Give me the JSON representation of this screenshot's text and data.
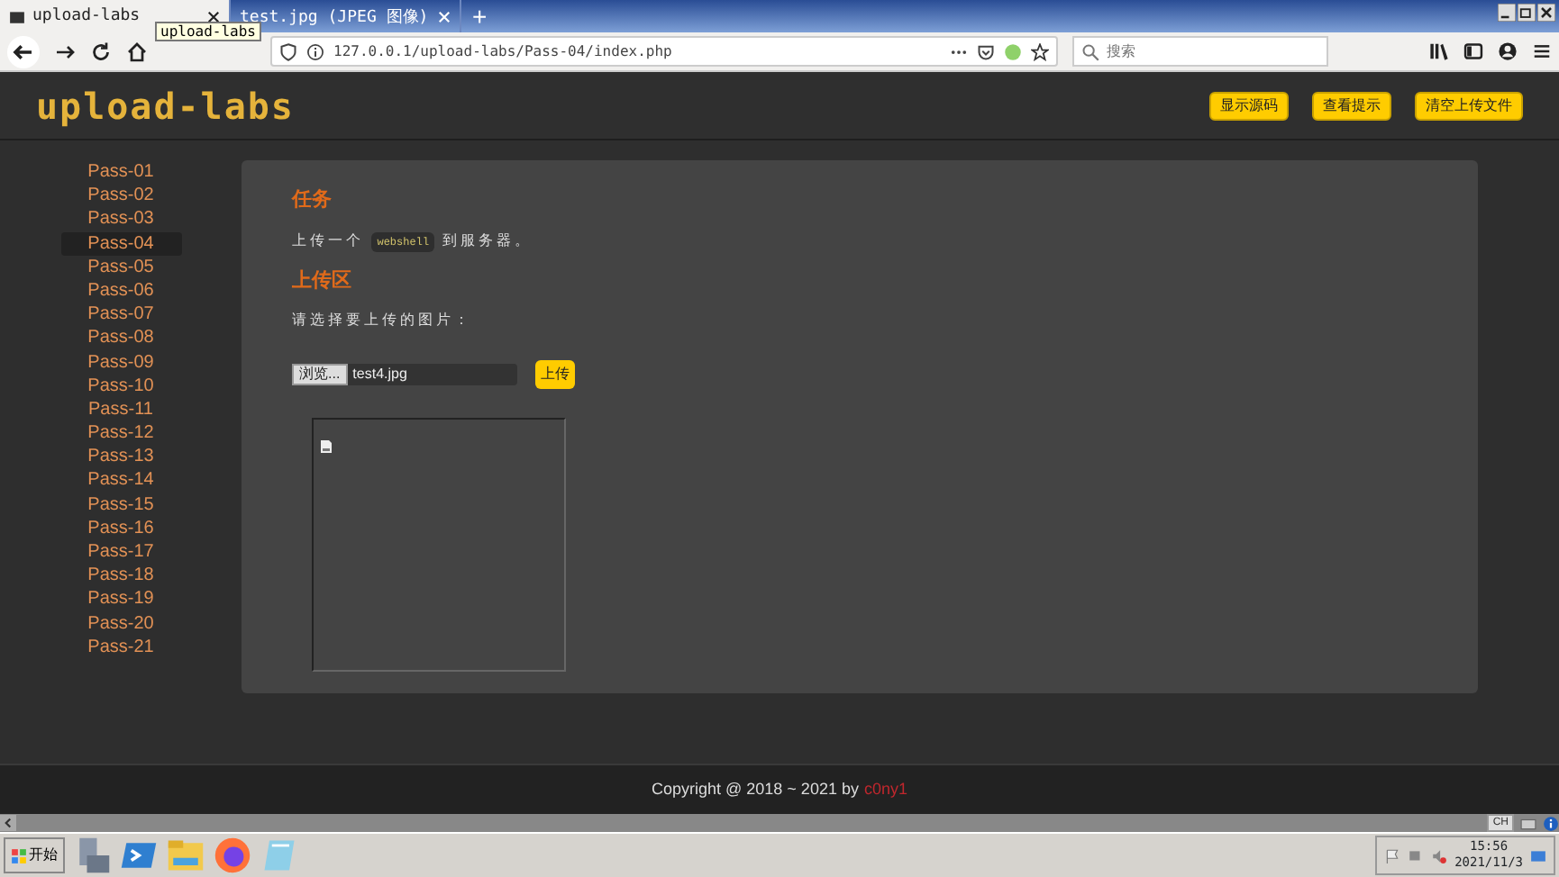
{
  "browser": {
    "tabs": [
      {
        "label": "upload-labs",
        "selected": true
      },
      {
        "label": "test.jpg (JPEG 图像)",
        "selected": false
      }
    ],
    "tooltip": "upload-labs",
    "new_tab": "+",
    "address": "127.0.0.1/upload-labs/Pass-04/index.php",
    "search": {
      "placeholder": "搜索"
    }
  },
  "header": {
    "logo": "upload-labs",
    "buttons": [
      "显示源码",
      "查看提示",
      "清空上传文件"
    ]
  },
  "sidebar": {
    "items": [
      {
        "label": "Pass-01",
        "selected": false
      },
      {
        "label": "Pass-02",
        "selected": false
      },
      {
        "label": "Pass-03",
        "selected": false
      },
      {
        "label": "Pass-04",
        "selected": true
      },
      {
        "label": "Pass-05",
        "selected": false
      },
      {
        "label": "Pass-06",
        "selected": false
      },
      {
        "label": "Pass-07",
        "selected": false
      },
      {
        "label": "Pass-08",
        "selected": false
      },
      {
        "label": "Pass-09",
        "selected": false
      },
      {
        "label": "Pass-10",
        "selected": false
      },
      {
        "label": "Pass-11",
        "selected": false
      },
      {
        "label": "Pass-12",
        "selected": false
      },
      {
        "label": "Pass-13",
        "selected": false
      },
      {
        "label": "Pass-14",
        "selected": false
      },
      {
        "label": "Pass-15",
        "selected": false
      },
      {
        "label": "Pass-16",
        "selected": false
      },
      {
        "label": "Pass-17",
        "selected": false
      },
      {
        "label": "Pass-18",
        "selected": false
      },
      {
        "label": "Pass-19",
        "selected": false
      },
      {
        "label": "Pass-20",
        "selected": false
      },
      {
        "label": "Pass-21",
        "selected": false
      }
    ]
  },
  "task": {
    "title": "任务",
    "before": "上传一个",
    "code": "webshell",
    "after": "到服务器。"
  },
  "upload": {
    "title": "上传区",
    "prompt": "请选择要上传的图片：",
    "browse": "浏览...",
    "file": "test4.jpg",
    "submit": "上传"
  },
  "footer": {
    "text": "Copyright @ 2018 ~ 2021 by",
    "author": "c0ny1"
  },
  "taskbar": {
    "start": "开始",
    "language": "CH",
    "time": "15:56",
    "date": "2021/11/3"
  }
}
